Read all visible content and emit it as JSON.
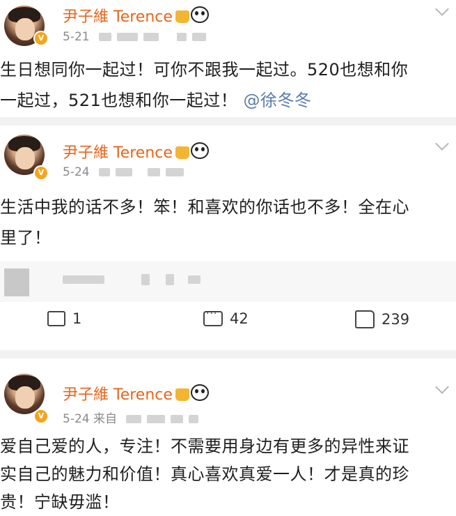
{
  "posts": [
    {
      "name": "尹子維 Terence",
      "date": "5-21",
      "source": "",
      "content_lines": [
        "生日想同你一起过！可你不跟我一起过。520也想和你",
        "一起过，521也想和你一起过！"
      ],
      "mention": "@徐冬冬"
    },
    {
      "name": "尹子維 Terence",
      "date": "5-24",
      "source": "",
      "content_lines": [
        "生活中我的话不多！笨！和喜欢的你话也不多！全在心",
        "里了！"
      ],
      "actions": {
        "share": "1",
        "comment": "42",
        "like": "239"
      }
    },
    {
      "name": "尹子維 Terence",
      "date": "5-24",
      "source": "来自",
      "content_lines": [
        "爱自己爱的人，专注！不需要用身边有更多的异性来证",
        "实自己的魅力和价值！真心喜欢真爱一人！才是真的珍",
        "贵！宁缺毋滥！"
      ]
    }
  ],
  "icons": {
    "verified": "verified-badge-icon",
    "crown": "crown-icon",
    "panda": "panda-icon",
    "more": "chevron-down-icon",
    "share": "share-icon",
    "comment": "comment-icon",
    "like": "like-icon"
  },
  "colors": {
    "name": "#e8651a",
    "mention": "#5a7dab",
    "meta": "#8a8a8a"
  }
}
